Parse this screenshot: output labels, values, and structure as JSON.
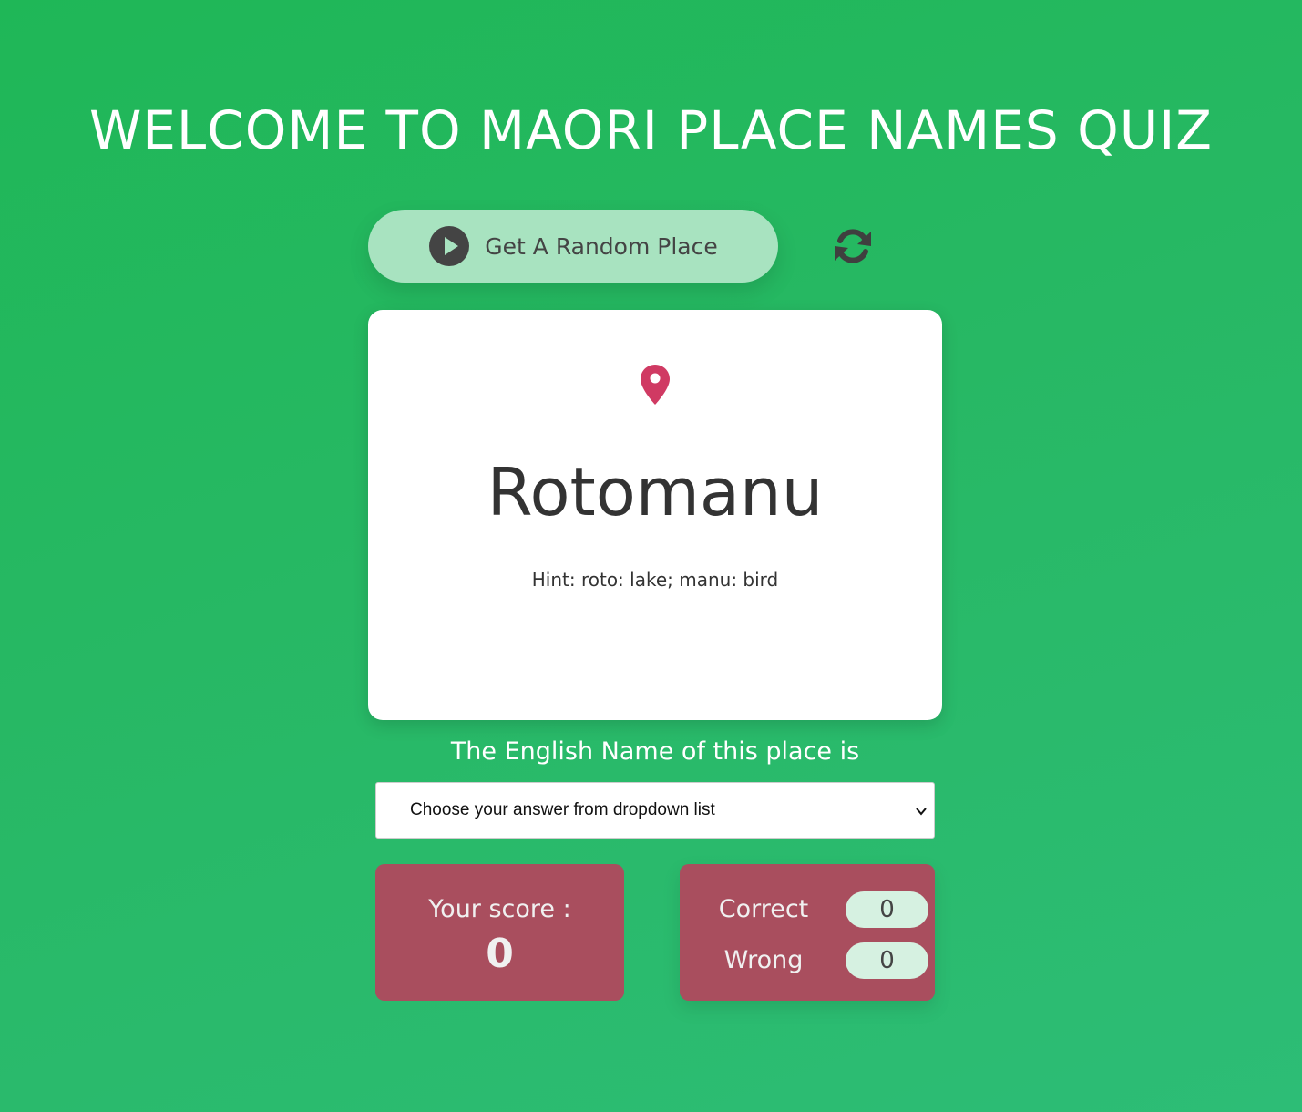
{
  "header": {
    "title": "WELCOME TO MAORI PLACE NAMES QUIZ"
  },
  "controls": {
    "random_button_label": "Get A Random Place",
    "random_button_icon": "play-circle-icon",
    "refresh_icon": "refresh-icon"
  },
  "card": {
    "icon": "map-pin-icon",
    "place_name": "Rotomanu",
    "hint": "Hint: roto: lake; manu: bird"
  },
  "question": {
    "label": "The English Name of this place is",
    "select_value": "Choose your answer from dropdown list"
  },
  "score": {
    "label": "Your score :",
    "value": "0"
  },
  "tally": {
    "correct_label": "Correct",
    "correct_value": "0",
    "wrong_label": "Wrong",
    "wrong_value": "0"
  },
  "colors": {
    "background": "#22b75d",
    "button_bg": "#a8e3c0",
    "score_bg": "#a94e5e",
    "pin": "#d03a63",
    "pill_bg": "#d6f1e1"
  }
}
